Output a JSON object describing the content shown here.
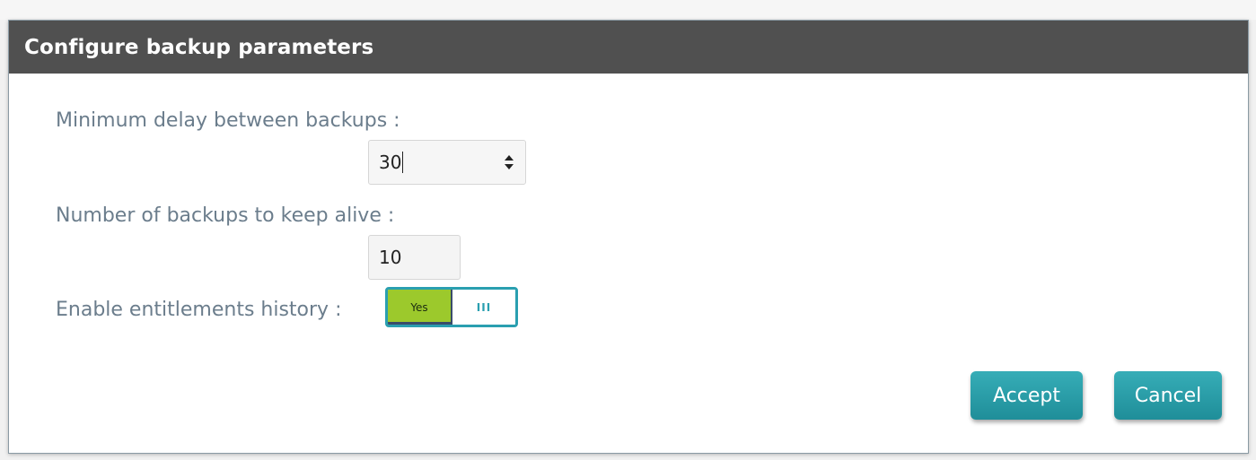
{
  "dialog": {
    "title": "Configure backup parameters"
  },
  "fields": {
    "min_delay": {
      "label": "Minimum delay between backups :",
      "value": "30"
    },
    "keep_alive": {
      "label": "Number of backups to keep alive :",
      "value": "10"
    },
    "entitlements": {
      "label": "Enable entitlements history :",
      "on_label": "Yes",
      "handle_label": "III",
      "state": "on"
    }
  },
  "buttons": {
    "accept_label": "Accept",
    "cancel_label": "Cancel"
  },
  "colors": {
    "titlebar": "#505050",
    "label_text": "#6b7d8c",
    "toggle_on": "#9cc92c",
    "toggle_border": "#2a9fb0",
    "button": "#2a9fa9"
  },
  "icons": {
    "spinner": "spinner-arrows-icon"
  }
}
